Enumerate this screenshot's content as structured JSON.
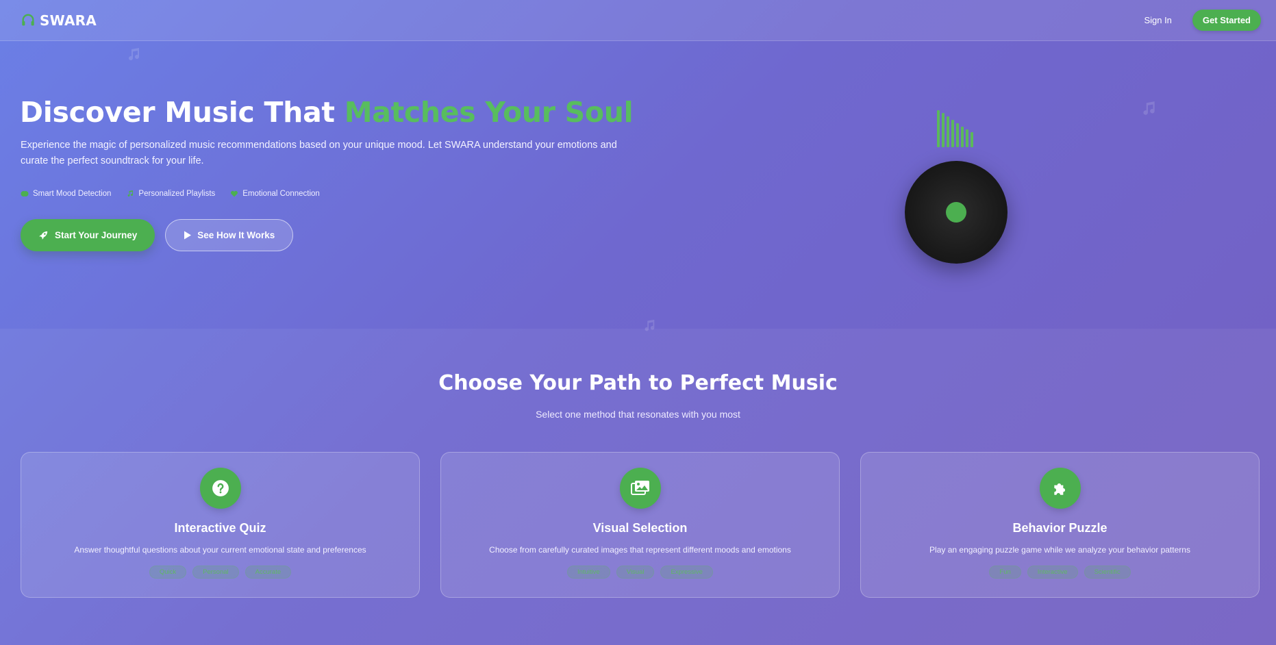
{
  "nav": {
    "brand": "SWARA",
    "brand_icon": "headphones-icon",
    "signin_label": "Sign In",
    "get_started_label": "Get Started"
  },
  "hero": {
    "title_main": "Discover Music That ",
    "title_accent": "Matches Your Soul",
    "description": "Experience the magic of personalized music recommendations based on your unique mood. Let SWARA understand your emotions and curate the perfect soundtrack for your life.",
    "features": [
      {
        "label": "Smart Mood Detection",
        "icon": "brain-icon"
      },
      {
        "label": "Personalized Playlists",
        "icon": "music-note-icon"
      },
      {
        "label": "Emotional Connection",
        "icon": "heart-icon"
      }
    ],
    "primary_button": {
      "label": "Start Your Journey",
      "icon": "rocket-icon"
    },
    "secondary_button": {
      "label": "See How It Works",
      "icon": "play-icon"
    }
  },
  "paths": {
    "title": "Choose Your Path to Perfect Music",
    "subtitle": "Select one method that resonates with you most",
    "cards": [
      {
        "title": "Interactive Quiz",
        "description": "Answer thoughtful questions about your current emotional state and preferences",
        "icon": "question-circle-icon",
        "tags": [
          "Quick",
          "Personal",
          "Accurate"
        ]
      },
      {
        "title": "Visual Selection",
        "description": "Choose from carefully curated images that represent different moods and emotions",
        "icon": "images-icon",
        "tags": [
          "Intuitive",
          "Visual",
          "Expressive"
        ]
      },
      {
        "title": "Behavior Puzzle",
        "description": "Play an engaging puzzle game while we analyze your behavior patterns",
        "icon": "puzzle-icon",
        "tags": [
          "Fun",
          "Interactive",
          "Scientific"
        ]
      }
    ]
  },
  "colors": {
    "accent_green": "#4caf50",
    "background_start": "#6b7fe6",
    "background_end": "#7460c2",
    "vinyl": "#1a1a1a"
  }
}
